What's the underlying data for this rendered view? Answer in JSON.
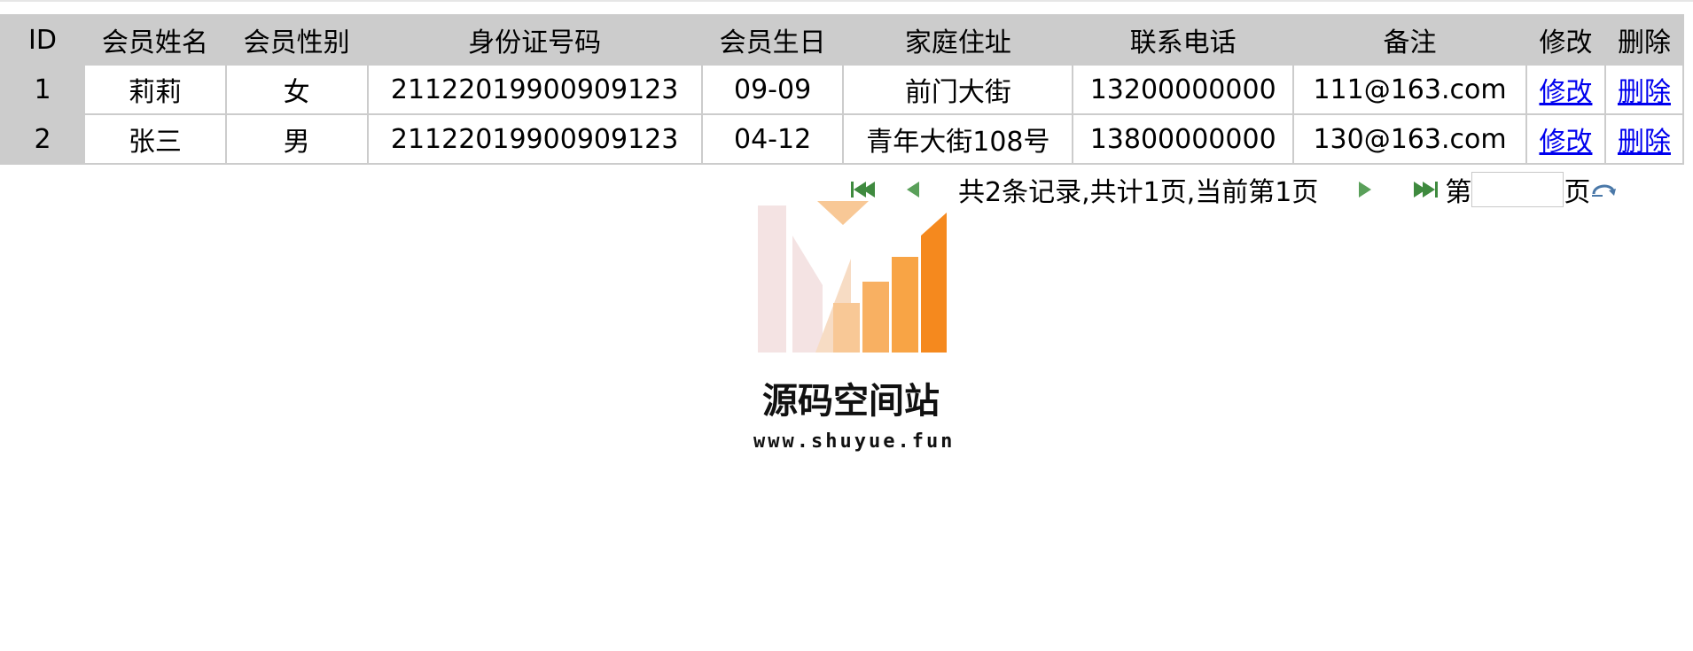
{
  "table": {
    "headers": [
      "ID",
      "会员姓名",
      "会员性别",
      "身份证号码",
      "会员生日",
      "家庭住址",
      "联系电话",
      "备注",
      "修改",
      "删除"
    ],
    "rows": [
      {
        "id": "1",
        "name": "莉莉",
        "gender": "女",
        "id_number": "21122019900909123",
        "birthday": "09-09",
        "address": "前门大街",
        "phone": "13200000000",
        "note": "111@163.com",
        "edit": "修改",
        "delete": "删除"
      },
      {
        "id": "2",
        "name": "张三",
        "gender": "男",
        "id_number": "21122019900909123",
        "birthday": "04-12",
        "address": "青年大街108号",
        "phone": "13800000000",
        "note": "130@163.com",
        "edit": "修改",
        "delete": "删除"
      }
    ]
  },
  "pager": {
    "first_icon": "first-page-icon",
    "prev_icon": "previous-page-icon",
    "summary": "共2条记录,共计1页,当前第1页",
    "next_icon": "next-page-icon",
    "last_icon": "last-page-icon",
    "goto_prefix": "第",
    "goto_value": "",
    "goto_suffix": "页",
    "go_icon": "refresh-go-icon"
  },
  "watermark": {
    "name": "源码空间站",
    "url": "www.shuyue.fun"
  },
  "colors": {
    "header_bg": "#cccccc",
    "link": "#0000ee",
    "pager_arrow": "#5aa05a",
    "logo_orange": "#f5891e",
    "logo_pink": "#f4e3e3"
  }
}
